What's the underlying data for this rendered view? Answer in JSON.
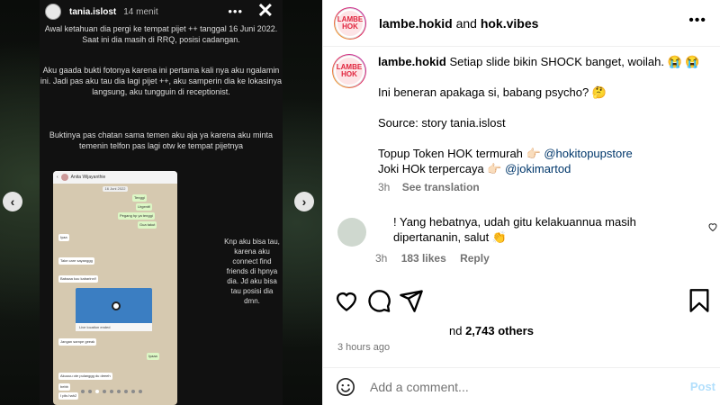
{
  "story": {
    "username": "tania.islost",
    "time": "14 menit",
    "text1": "Awal ketahuan dia pergi ke tempat pijet ++ tanggal 16 Juni 2022. Saat ini dia masih di RRQ, posisi cadangan.",
    "text2": "Aku gaada bukti fotonya karena ini pertama kali nya aku ngalamin ini. Jadi pas aku tau dia lagi pijet ++, aku samperin dia ke lokasinya langsung, aku tungguin di receptionist.",
    "text3": "Buktinya pas chatan sama temen aku aja ya karena aku minta temenin telfon pas lagi otw ke tempat pijetnya",
    "side_text": "Knp aku bisa tau, karena aku connect find friends di hpnya dia. Jd aku bisa tau posisi dia dmn.",
    "chat": {
      "contact": "Anita Wijayanthie",
      "date": "16 Juni 2022",
      "messages": [
        "Tenggi",
        "Urgentt!",
        "Pegang hp ya tenggi",
        "Gua takut",
        "Iyaa",
        "Take care sayanggg",
        "Babaaa kuu kabarinn!!",
        "Jangan sampe geeak",
        "Iyaaa",
        "Akuuuu ote pulanggg du deeeh",
        "bebb",
        "I plis hah2"
      ],
      "map_caption": "Live location ended"
    },
    "slides_total": 9,
    "slides_active": 3
  },
  "post": {
    "header": {
      "account": "lambe.hokid",
      "conjunction": " and ",
      "collab": "hok.vibes"
    },
    "avatar_text": "LAMBE HOK",
    "caption": {
      "username": "lambe.hokid",
      "line1": " Setiap slide bikin SHOCK banget, woilah. 😭 😭",
      "line2": "Ini beneran apakaga si, babang psycho? 🤔",
      "line3": "Source: story tania.islost",
      "line4a": "Topup Token HOK termurah 👉🏻 ",
      "line4b": "@hokitopupstore",
      "line5a": "Joki HOk terpercaya 👉🏻 ",
      "line5b": "@jokimartod",
      "time": "3h",
      "see_translation": "See translation"
    },
    "comment": {
      "text_pre": "! Yang hebatnya, udah gitu kelakuannua masih dipertananin, salut 👏",
      "time": "3h",
      "likes": "183 likes",
      "reply": "Reply"
    },
    "likes": {
      "prefix": "nd ",
      "count": "2,743 others"
    },
    "posted": "3 hours ago",
    "add_comment_placeholder": "Add a comment...",
    "post_label": "Post"
  }
}
